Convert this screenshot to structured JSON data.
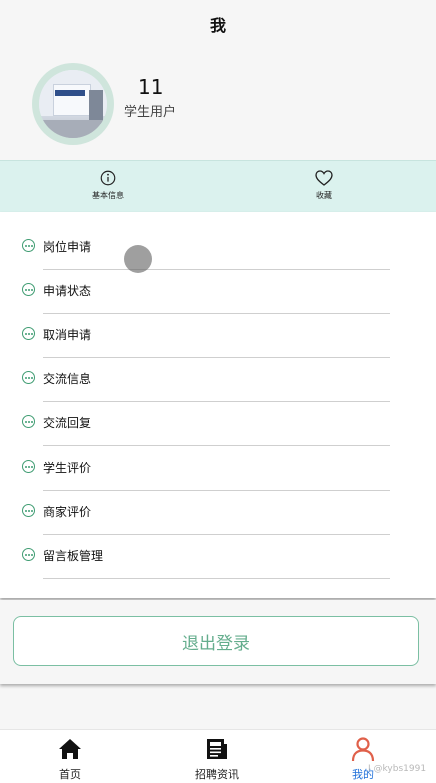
{
  "header": {
    "title": "我"
  },
  "profile": {
    "name": "11",
    "role": "学生用户"
  },
  "quick": {
    "left_label": "基本信息",
    "right_label": "收藏"
  },
  "menu": {
    "items": [
      {
        "label": "岗位申请"
      },
      {
        "label": "申请状态"
      },
      {
        "label": "取消申请"
      },
      {
        "label": "交流信息"
      },
      {
        "label": "交流回复"
      },
      {
        "label": "学生评价"
      },
      {
        "label": "商家评价"
      },
      {
        "label": "留言板管理"
      }
    ]
  },
  "logout": {
    "label": "退出登录"
  },
  "tabbar": {
    "items": [
      {
        "label": "首页"
      },
      {
        "label": "招聘资讯"
      },
      {
        "label": "我的"
      }
    ]
  },
  "watermark": "I @kybs1991",
  "colors": {
    "accent_green": "#64ad8d",
    "quick_bar_bg": "#dbf2ee",
    "active_tab": "#1e6fd9",
    "mine_icon": "#e0604a"
  }
}
